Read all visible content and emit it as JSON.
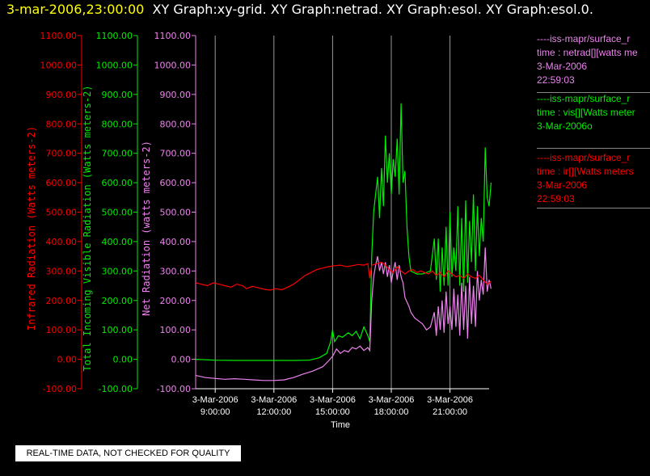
{
  "title": {
    "date": "3-mar-2006,23:00:00",
    "graphs": "XY Graph:xy-grid.  XY Graph:netrad.  XY Graph:esol.  XY Graph:esol.0."
  },
  "colors": {
    "infrared": "#ff0000",
    "visible": "#00ee00",
    "net": "#ee82ee",
    "grid": "#999999",
    "axis": "#ffffff"
  },
  "legend": [
    {
      "color": "#ee82ee",
      "lines": [
        "----iss-mapr/surface_r",
        "time : netrad[][watts me",
        "3-Mar-2006",
        "22:59:03"
      ]
    },
    {
      "color": "#00ee00",
      "lines": [
        "----iss-mapr/surface_r",
        "time : vis[][Watts meter",
        "3-Mar-2006o"
      ]
    },
    {
      "color": "#ff0000",
      "lines": [
        "----iss-mapr/surface_r",
        "time : ir[][Watts meters",
        "3-Mar-2006",
        "22:59:03"
      ]
    }
  ],
  "quality_note": "REAL-TIME DATA, NOT CHECKED FOR QUALITY",
  "chart_data": {
    "type": "line",
    "xlabel": "Time",
    "x_ticks": [
      {
        "hour": 9,
        "date": "3-Mar-2006",
        "time": "9:00:00"
      },
      {
        "hour": 12,
        "date": "3-Mar-2006",
        "time": "12:00:00"
      },
      {
        "hour": 15,
        "date": "3-Mar-2006",
        "time": "15:00:00"
      },
      {
        "hour": 18,
        "date": "3-Mar-2006",
        "time": "18:00:00"
      },
      {
        "hour": 21,
        "date": "3-Mar-2006",
        "time": "21:00:00"
      }
    ],
    "xlim": [
      8.0,
      23.0
    ],
    "grid": "vertical",
    "y_axes": [
      {
        "id": "ir",
        "label": "Infrared Radiation (Watts meters-2)",
        "ylim": [
          -100,
          1100
        ],
        "ticks": [
          "-100.00",
          "0.00",
          "100.00",
          "200.00",
          "300.00",
          "400.00",
          "500.00",
          "600.00",
          "700.00",
          "800.00",
          "900.00",
          "1000.00",
          "1100.00"
        ]
      },
      {
        "id": "vis",
        "label": "Total Incoming Visible Radiation (Watts meters-2)",
        "ylim": [
          -100,
          1100
        ],
        "ticks": [
          "-100.00",
          "0.00",
          "100.00",
          "200.00",
          "300.00",
          "400.00",
          "500.00",
          "600.00",
          "700.00",
          "800.00",
          "900.00",
          "1000.00",
          "1100.00"
        ]
      },
      {
        "id": "net",
        "label": "Net Radiation (watts meters-2)",
        "ylim": [
          -100,
          1100
        ],
        "ticks": [
          "-100.00",
          "0.00",
          "100.00",
          "200.00",
          "300.00",
          "400.00",
          "500.00",
          "600.00",
          "700.00",
          "800.00",
          "900.00",
          "1000.00",
          "1100.00"
        ]
      }
    ],
    "series": [
      {
        "axis": "vis",
        "points": [
          [
            8.0,
            0
          ],
          [
            9.0,
            -3
          ],
          [
            10.0,
            -4
          ],
          [
            11.0,
            -4
          ],
          [
            12.0,
            -4
          ],
          [
            13.0,
            -4
          ],
          [
            13.8,
            -3
          ],
          [
            14.3,
            5
          ],
          [
            14.7,
            20
          ],
          [
            14.9,
            60
          ],
          [
            15.0,
            100
          ],
          [
            15.1,
            60
          ],
          [
            15.3,
            80
          ],
          [
            15.5,
            75
          ],
          [
            15.8,
            90
          ],
          [
            16.0,
            80
          ],
          [
            16.2,
            95
          ],
          [
            16.4,
            70
          ],
          [
            16.6,
            110
          ],
          [
            16.8,
            80
          ],
          [
            16.9,
            60
          ],
          [
            17.0,
            350
          ],
          [
            17.1,
            500
          ],
          [
            17.2,
            560
          ],
          [
            17.3,
            620
          ],
          [
            17.4,
            480
          ],
          [
            17.5,
            650
          ],
          [
            17.6,
            520
          ],
          [
            17.7,
            760
          ],
          [
            17.8,
            600
          ],
          [
            17.9,
            700
          ],
          [
            18.0,
            560
          ],
          [
            18.1,
            680
          ],
          [
            18.2,
            620
          ],
          [
            18.3,
            750
          ],
          [
            18.4,
            560
          ],
          [
            18.5,
            870
          ],
          [
            18.6,
            600
          ],
          [
            18.7,
            640
          ],
          [
            18.8,
            450
          ],
          [
            18.9,
            350
          ],
          [
            19.0,
            300
          ],
          [
            19.3,
            290
          ],
          [
            19.6,
            290
          ],
          [
            20.0,
            300
          ],
          [
            20.2,
            410
          ],
          [
            20.3,
            270
          ],
          [
            20.4,
            410
          ],
          [
            20.5,
            230
          ],
          [
            20.6,
            380
          ],
          [
            20.7,
            250
          ],
          [
            20.8,
            450
          ],
          [
            20.9,
            250
          ],
          [
            21.0,
            500
          ],
          [
            21.1,
            280
          ],
          [
            21.2,
            380
          ],
          [
            21.3,
            300
          ],
          [
            21.4,
            520
          ],
          [
            21.5,
            250
          ],
          [
            21.6,
            480
          ],
          [
            21.7,
            230
          ],
          [
            21.8,
            540
          ],
          [
            21.9,
            260
          ],
          [
            22.0,
            470
          ],
          [
            22.1,
            330
          ],
          [
            22.2,
            560
          ],
          [
            22.3,
            300
          ],
          [
            22.4,
            520
          ],
          [
            22.5,
            350
          ],
          [
            22.6,
            480
          ],
          [
            22.7,
            400
          ],
          [
            22.8,
            720
          ],
          [
            22.9,
            550
          ],
          [
            23.0,
            520
          ],
          [
            23.1,
            600
          ]
        ]
      },
      {
        "axis": "net",
        "points": [
          [
            8.0,
            -55
          ],
          [
            8.5,
            -62
          ],
          [
            9.0,
            -65
          ],
          [
            9.5,
            -68
          ],
          [
            10.0,
            -66
          ],
          [
            10.5,
            -68
          ],
          [
            11.0,
            -70
          ],
          [
            11.5,
            -72
          ],
          [
            12.0,
            -72
          ],
          [
            12.5,
            -70
          ],
          [
            13.0,
            -62
          ],
          [
            13.5,
            -50
          ],
          [
            14.0,
            -40
          ],
          [
            14.5,
            -25
          ],
          [
            14.8,
            -5
          ],
          [
            15.0,
            10
          ],
          [
            15.2,
            35
          ],
          [
            15.4,
            20
          ],
          [
            15.6,
            30
          ],
          [
            15.8,
            25
          ],
          [
            16.0,
            40
          ],
          [
            16.2,
            35
          ],
          [
            16.4,
            45
          ],
          [
            16.6,
            30
          ],
          [
            16.8,
            40
          ],
          [
            16.9,
            30
          ],
          [
            17.0,
            200
          ],
          [
            17.1,
            280
          ],
          [
            17.2,
            320
          ],
          [
            17.3,
            350
          ],
          [
            17.4,
            300
          ],
          [
            17.5,
            330
          ],
          [
            17.6,
            290
          ],
          [
            17.7,
            330
          ],
          [
            17.8,
            280
          ],
          [
            17.9,
            320
          ],
          [
            18.0,
            260
          ],
          [
            18.1,
            300
          ],
          [
            18.2,
            330
          ],
          [
            18.3,
            270
          ],
          [
            18.4,
            320
          ],
          [
            18.5,
            280
          ],
          [
            18.6,
            260
          ],
          [
            18.7,
            210
          ],
          [
            18.9,
            180
          ],
          [
            19.0,
            160
          ],
          [
            19.2,
            140
          ],
          [
            19.4,
            130
          ],
          [
            19.6,
            120
          ],
          [
            19.8,
            100
          ],
          [
            20.0,
            110
          ],
          [
            20.2,
            160
          ],
          [
            20.3,
            80
          ],
          [
            20.4,
            180
          ],
          [
            20.5,
            100
          ],
          [
            20.6,
            200
          ],
          [
            20.7,
            90
          ],
          [
            20.8,
            230
          ],
          [
            20.9,
            120
          ],
          [
            21.0,
            180
          ],
          [
            21.1,
            100
          ],
          [
            21.2,
            240
          ],
          [
            21.3,
            110
          ],
          [
            21.4,
            220
          ],
          [
            21.5,
            80
          ],
          [
            21.6,
            260
          ],
          [
            21.7,
            100
          ],
          [
            21.8,
            250
          ],
          [
            21.9,
            70
          ],
          [
            22.0,
            280
          ],
          [
            22.1,
            120
          ],
          [
            22.2,
            250
          ],
          [
            22.3,
            110
          ],
          [
            22.4,
            300
          ],
          [
            22.5,
            200
          ],
          [
            22.6,
            270
          ],
          [
            22.7,
            220
          ],
          [
            22.8,
            380
          ],
          [
            22.9,
            230
          ],
          [
            23.0,
            270
          ],
          [
            23.1,
            240
          ]
        ]
      },
      {
        "axis": "ir",
        "points": [
          [
            8.0,
            260
          ],
          [
            8.3,
            255
          ],
          [
            8.6,
            250
          ],
          [
            8.9,
            260
          ],
          [
            9.2,
            255
          ],
          [
            9.5,
            250
          ],
          [
            9.8,
            245
          ],
          [
            10.1,
            255
          ],
          [
            10.4,
            250
          ],
          [
            10.6,
            240
          ],
          [
            10.9,
            248
          ],
          [
            11.2,
            243
          ],
          [
            11.5,
            238
          ],
          [
            11.8,
            235
          ],
          [
            12.1,
            240
          ],
          [
            12.4,
            236
          ],
          [
            12.7,
            245
          ],
          [
            13.0,
            255
          ],
          [
            13.3,
            270
          ],
          [
            13.6,
            285
          ],
          [
            13.9,
            295
          ],
          [
            14.2,
            305
          ],
          [
            14.5,
            310
          ],
          [
            14.8,
            315
          ],
          [
            15.1,
            318
          ],
          [
            15.4,
            320
          ],
          [
            15.7,
            315
          ],
          [
            16.0,
            318
          ],
          [
            16.3,
            322
          ],
          [
            16.6,
            320
          ],
          [
            16.8,
            325
          ],
          [
            16.9,
            275
          ],
          [
            17.0,
            320
          ],
          [
            17.3,
            325
          ],
          [
            17.5,
            330
          ],
          [
            17.7,
            320
          ],
          [
            17.9,
            305
          ],
          [
            18.1,
            295
          ],
          [
            18.3,
            315
          ],
          [
            18.5,
            300
          ],
          [
            18.7,
            290
          ],
          [
            18.9,
            300
          ],
          [
            19.1,
            305
          ],
          [
            19.3,
            295
          ],
          [
            19.5,
            300
          ],
          [
            19.7,
            295
          ],
          [
            19.9,
            290
          ],
          [
            20.1,
            300
          ],
          [
            20.3,
            285
          ],
          [
            20.5,
            295
          ],
          [
            20.7,
            280
          ],
          [
            20.9,
            300
          ],
          [
            21.1,
            290
          ],
          [
            21.3,
            280
          ],
          [
            21.5,
            285
          ],
          [
            21.7,
            275
          ],
          [
            21.9,
            290
          ],
          [
            22.1,
            280
          ],
          [
            22.3,
            275
          ],
          [
            22.5,
            285
          ],
          [
            22.7,
            270
          ],
          [
            22.9,
            255
          ],
          [
            23.1,
            265
          ]
        ]
      }
    ]
  }
}
